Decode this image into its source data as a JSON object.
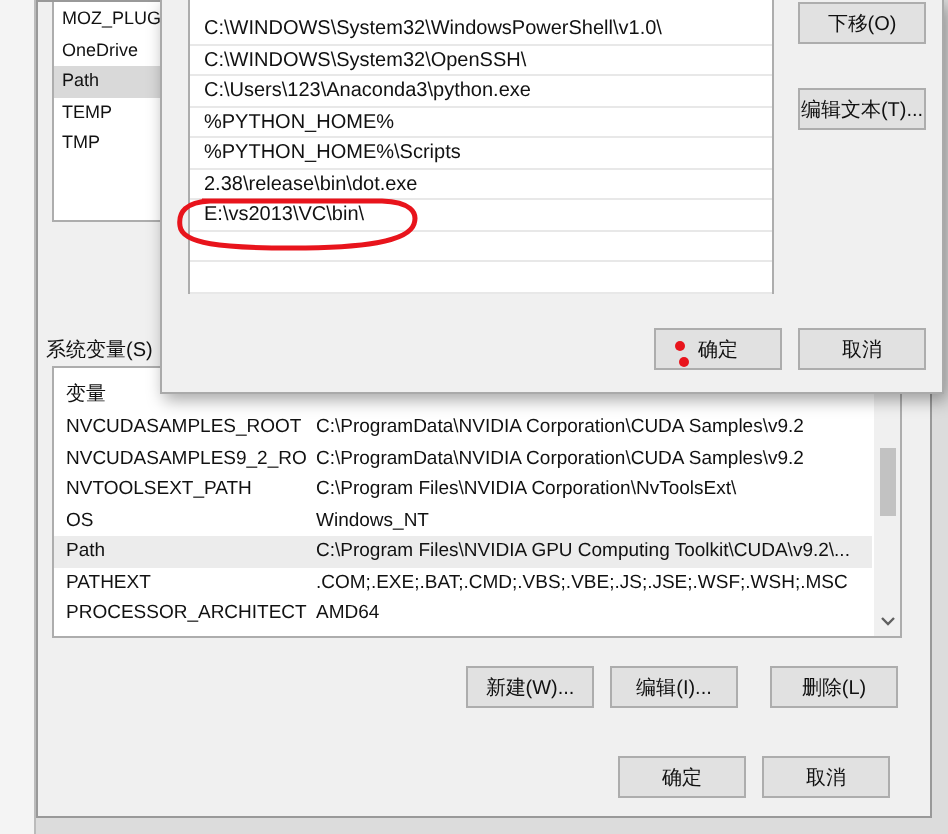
{
  "environment_window": {
    "user_variables": [
      {
        "name": "MOZ_PLUG",
        "selected": false
      },
      {
        "name": "OneDrive",
        "selected": false
      },
      {
        "name": "Path",
        "selected": true
      },
      {
        "name": "TEMP",
        "selected": false
      },
      {
        "name": "TMP",
        "selected": false
      }
    ],
    "system_variables": {
      "label": "系统变量(S)",
      "columns": [
        "变量"
      ],
      "rows": [
        {
          "name": "NVCUDASAMPLES_ROOT",
          "value": "C:\\ProgramData\\NVIDIA Corporation\\CUDA Samples\\v9.2",
          "selected": false
        },
        {
          "name": "NVCUDASAMPLES9_2_RO",
          "value": "C:\\ProgramData\\NVIDIA Corporation\\CUDA Samples\\v9.2",
          "selected": false
        },
        {
          "name": "NVTOOLSEXT_PATH",
          "value": "C:\\Program Files\\NVIDIA Corporation\\NvToolsExt\\",
          "selected": false
        },
        {
          "name": "OS",
          "value": "Windows_NT",
          "selected": false
        },
        {
          "name": "Path",
          "value": "C:\\Program Files\\NVIDIA GPU Computing Toolkit\\CUDA\\v9.2\\...",
          "selected": true
        },
        {
          "name": "PATHEXT",
          "value": ".COM;.EXE;.BAT;.CMD;.VBS;.VBE;.JS;.JSE;.WSF;.WSH;.MSC",
          "selected": false
        },
        {
          "name": "PROCESSOR_ARCHITECT",
          "value": "AMD64",
          "selected": false
        }
      ],
      "buttons": [
        "新建(W)...",
        "编辑(I)...",
        "删除(L)"
      ]
    },
    "buttons": [
      "确定",
      "取消"
    ]
  },
  "edit_dialog": {
    "entries": [
      {
        "text": "C:\\WINDOWS\\System32\\WindowsPowerShell\\v1.0\\",
        "selected": false
      },
      {
        "text": "C:\\WINDOWS\\System32\\OpenSSH\\",
        "selected": false
      },
      {
        "text": "C:\\Users\\123\\Anaconda3\\python.exe",
        "selected": false
      },
      {
        "text": "%PYTHON_HOME%",
        "selected": false
      },
      {
        "text": "%PYTHON_HOME%\\Scripts",
        "selected": false
      },
      {
        "text": "2.38\\release\\bin\\dot.exe",
        "selected": false
      },
      {
        "text": "E:\\vs2013\\VC\\bin\\",
        "selected": false
      }
    ],
    "side_buttons": [
      "下移(O)",
      "编辑文本(T)..."
    ],
    "buttons": [
      "确定",
      "取消"
    ]
  }
}
